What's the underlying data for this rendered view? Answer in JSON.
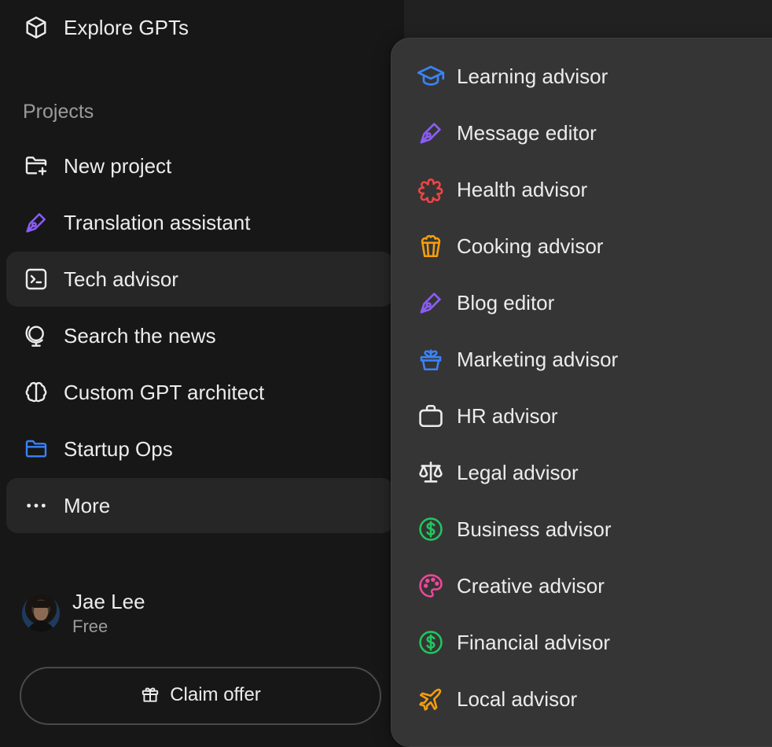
{
  "sidebar": {
    "explore": {
      "label": "Explore GPTs",
      "icon": "cube-icon"
    },
    "projects_label": "Projects",
    "items": [
      {
        "label": "New project",
        "icon": "folder-plus-icon"
      },
      {
        "label": "Translation assistant",
        "icon": "pen-nib-icon",
        "color": "#8b5cf6"
      },
      {
        "label": "Tech advisor",
        "icon": "terminal-icon"
      },
      {
        "label": "Search the news",
        "icon": "globe-stand-icon"
      },
      {
        "label": "Custom GPT architect",
        "icon": "brain-icon"
      },
      {
        "label": "Startup Ops",
        "icon": "folder-icon",
        "color": "#3b82f6"
      },
      {
        "label": "More",
        "icon": "ellipsis-icon"
      }
    ],
    "user": {
      "name": "Jae Lee",
      "plan": "Free"
    },
    "claim_offer": {
      "label": "Claim offer",
      "icon": "gift-icon"
    }
  },
  "menu": {
    "items": [
      {
        "label": "Learning advisor",
        "icon": "graduation-cap-icon",
        "color": "#3b82f6"
      },
      {
        "label": "Message editor",
        "icon": "pen-nib-icon",
        "color": "#8b5cf6"
      },
      {
        "label": "Health advisor",
        "icon": "medical-flower-icon",
        "color": "#ef4444"
      },
      {
        "label": "Cooking advisor",
        "icon": "popcorn-icon",
        "color": "#f59e0b"
      },
      {
        "label": "Blog editor",
        "icon": "pen-nib-icon",
        "color": "#8b5cf6"
      },
      {
        "label": "Marketing advisor",
        "icon": "plant-pot-icon",
        "color": "#3b82f6"
      },
      {
        "label": "HR advisor",
        "icon": "briefcase-icon",
        "color": "#ececec"
      },
      {
        "label": "Legal advisor",
        "icon": "scales-icon",
        "color": "#ececec"
      },
      {
        "label": "Business advisor",
        "icon": "dollar-circle-icon",
        "color": "#22c55e"
      },
      {
        "label": "Creative advisor",
        "icon": "palette-icon",
        "color": "#ec4899"
      },
      {
        "label": "Financial advisor",
        "icon": "dollar-circle-icon",
        "color": "#22c55e"
      },
      {
        "label": "Local advisor",
        "icon": "airplane-icon",
        "color": "#f59e0b"
      }
    ]
  }
}
